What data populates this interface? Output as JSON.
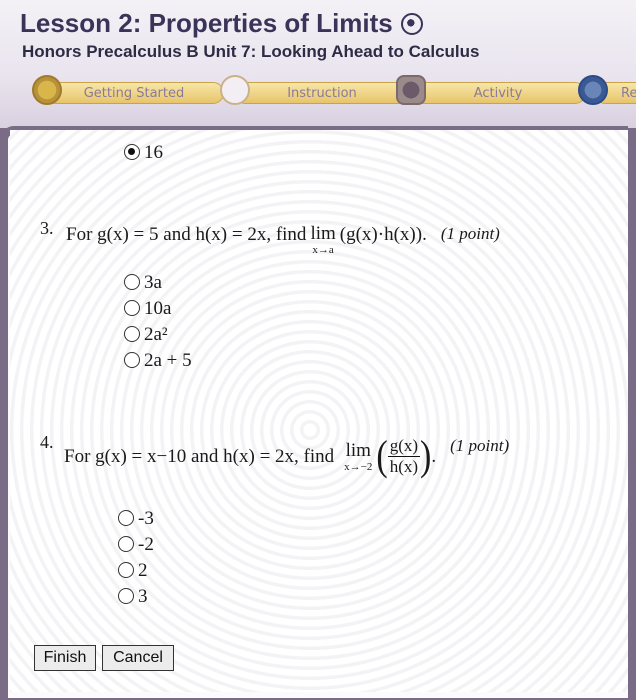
{
  "header": {
    "lesson_title": "Lesson 2: Properties of Limits",
    "subtitle": "Honors Precalculus B  Unit 7: Looking Ahead to Calculus"
  },
  "tabs": [
    {
      "label": "Getting Started",
      "icon": "getting-started-icon"
    },
    {
      "label": "Instruction",
      "icon": "instruction-icon"
    },
    {
      "label": "Activity",
      "icon": "activity-icon"
    },
    {
      "label": "Re",
      "icon": "review-icon"
    }
  ],
  "previous_answer": {
    "label": "16",
    "selected": true
  },
  "q3": {
    "number": "3.",
    "text_before": "For g(x) = 5 and h(x) = 2x, find",
    "lim_word": "lim",
    "lim_sub": "x→a",
    "lim_expr": "(g(x)·h(x)).",
    "points": "(1 point)",
    "choices": [
      "3a",
      "10a",
      "2a²",
      "2a + 5"
    ]
  },
  "q4": {
    "number": "4.",
    "text_before": "For g(x) = x−10 and h(x) = 2x, find",
    "lim_word": "lim",
    "lim_sub": "x→−2",
    "num": "g(x)",
    "den": "h(x)",
    "period": ".",
    "points": "(1 point)",
    "choices": [
      "-3",
      "-2",
      "2",
      "3"
    ]
  },
  "buttons": {
    "finish": "Finish",
    "cancel": "Cancel"
  },
  "colors": {
    "title": "#3a3458",
    "tab_gold": "#e8c46a",
    "frame": "#7a6b86"
  }
}
